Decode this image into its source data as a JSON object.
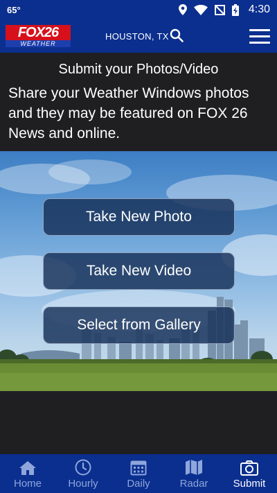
{
  "status_bar": {
    "temperature": "65°",
    "time": "4:30"
  },
  "header": {
    "logo_main": "FOX26",
    "logo_sub": "WEATHER",
    "location": "HOUSTON, TX"
  },
  "intro": {
    "title": "Submit your Photos/Video",
    "body": "Share your Weather Windows photos and they may be featured on FOX 26 News and online."
  },
  "actions": {
    "take_photo": "Take New Photo",
    "take_video": "Take New Video",
    "gallery": "Select from Gallery"
  },
  "bottom_nav": {
    "items": [
      {
        "label": "Home",
        "icon": "home-icon"
      },
      {
        "label": "Hourly",
        "icon": "clock-icon"
      },
      {
        "label": "Daily",
        "icon": "calendar-icon"
      },
      {
        "label": "Radar",
        "icon": "map-icon"
      },
      {
        "label": "Submit",
        "icon": "camera-icon"
      }
    ],
    "active": "Submit"
  },
  "colors": {
    "brand_blue": "#0b2f8e",
    "logo_red": "#d6111c",
    "background": "#1f1f22"
  }
}
